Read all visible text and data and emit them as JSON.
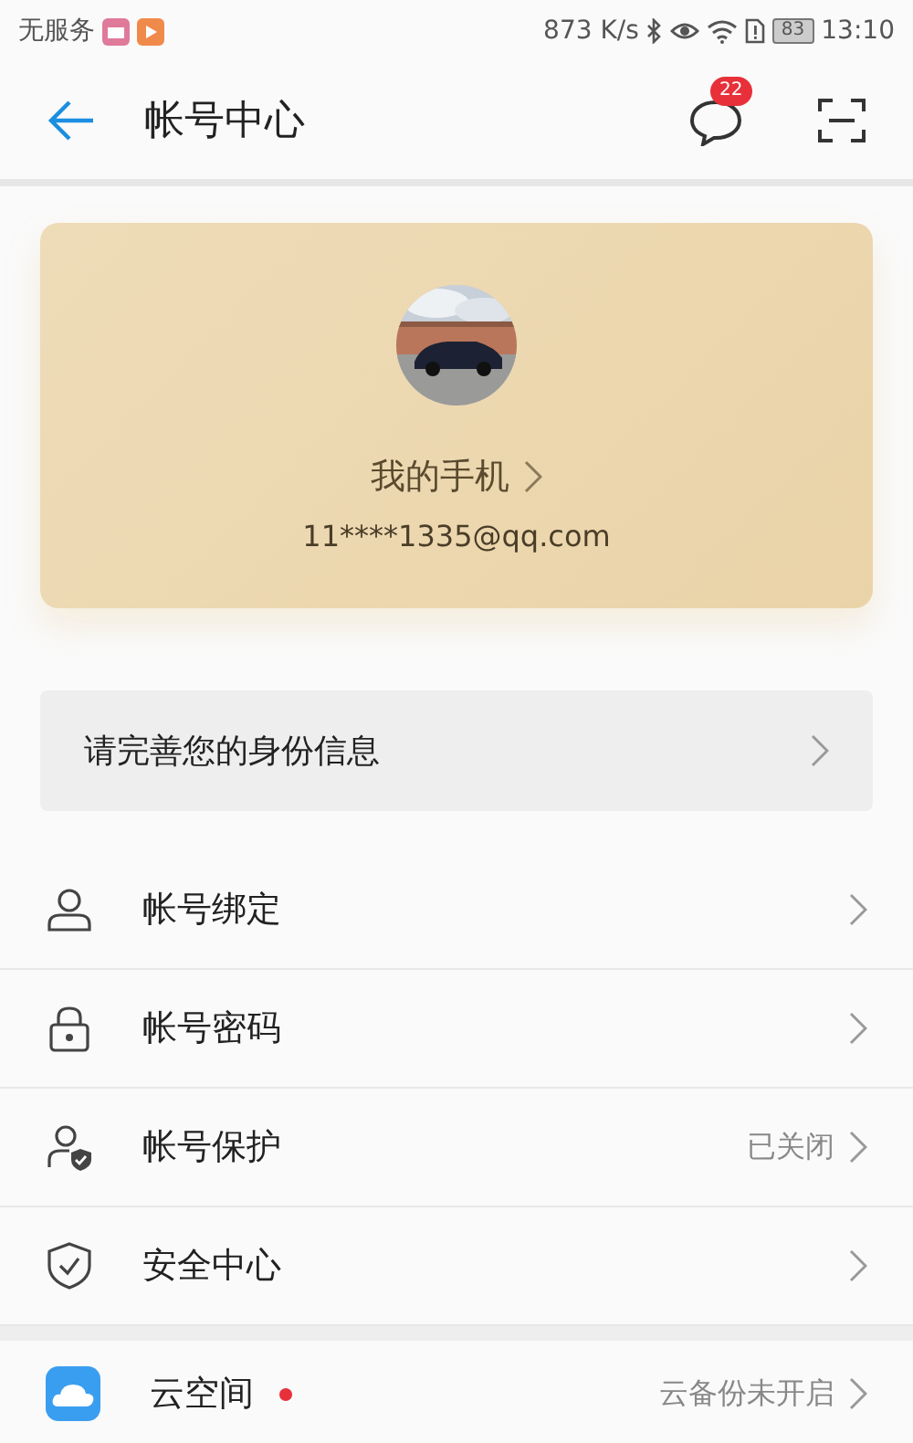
{
  "status_bar": {
    "carrier": "无服务",
    "speed": "873 K/s",
    "battery": "83",
    "time": "13:10"
  },
  "header": {
    "title": "帐号中心",
    "badge": "22"
  },
  "profile": {
    "name": "我的手机",
    "email": "11****1335@qq.com"
  },
  "banner": {
    "text": "请完善您的身份信息"
  },
  "menu": [
    {
      "kind": "person",
      "label": "帐号绑定"
    },
    {
      "kind": "lock",
      "label": "帐号密码"
    },
    {
      "kind": "person-shield",
      "label": "帐号保护",
      "value": "已关闭"
    },
    {
      "kind": "shield",
      "label": "安全中心"
    }
  ],
  "cloud": {
    "label": "云空间",
    "unread": true,
    "value": "云备份未开启"
  }
}
